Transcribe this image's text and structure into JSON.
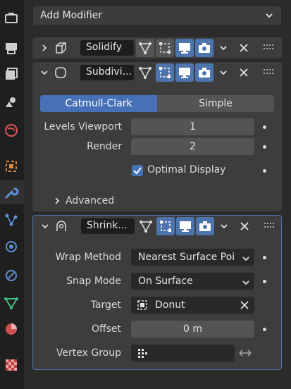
{
  "header": {
    "add_modifier_label": "Add Modifier"
  },
  "sidebar": {
    "items": [
      {
        "icon": "tool-icon"
      },
      {
        "icon": "render-icon"
      },
      {
        "icon": "output-icon"
      },
      {
        "icon": "view-layer-icon"
      },
      {
        "icon": "scene-icon"
      },
      {
        "icon": "world-icon"
      },
      {
        "icon": "object-icon"
      },
      {
        "icon": "modifier-icon"
      },
      {
        "icon": "particles-icon"
      },
      {
        "icon": "physics-icon"
      },
      {
        "icon": "constraints-icon"
      },
      {
        "icon": "data-icon"
      },
      {
        "icon": "material-icon"
      },
      {
        "icon": "texture-icon"
      }
    ],
    "active": "modifier-icon"
  },
  "modifiers": {
    "solidify": {
      "name": "Solidify",
      "expanded": false
    },
    "subdivision": {
      "name": "Subdivi...",
      "expanded": true,
      "mode_options": [
        "Catmull-Clark",
        "Simple"
      ],
      "mode_selected": "Catmull-Clark",
      "levels_viewport_label": "Levels Viewport",
      "levels_viewport_value": "1",
      "render_label": "Render",
      "render_value": "2",
      "optimal_display_label": "Optimal Display",
      "optimal_display_checked": true,
      "advanced_label": "Advanced"
    },
    "shrinkwrap": {
      "name": "Shrink...",
      "expanded": true,
      "selected": true,
      "wrap_method_label": "Wrap Method",
      "wrap_method_value": "Nearest Surface Poi",
      "snap_mode_label": "Snap Mode",
      "snap_mode_value": "On Surface",
      "target_label": "Target",
      "target_value": "Donut",
      "offset_label": "Offset",
      "offset_value": "0 m",
      "vertex_group_label": "Vertex Group",
      "vertex_group_value": ""
    }
  },
  "colors": {
    "accent": "#4771b6",
    "selected_outline": "#4b73b0",
    "panel": "#3d3d3d"
  }
}
